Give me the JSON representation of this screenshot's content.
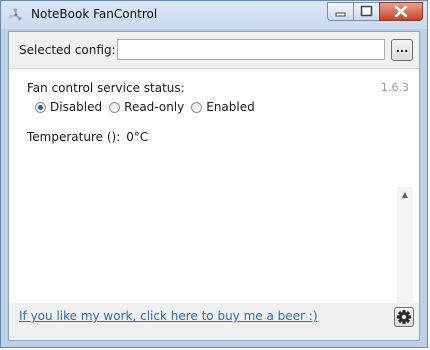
{
  "window": {
    "title": "NoteBook FanControl",
    "app_icon": "fan-icon",
    "caption_icons": [
      "minimize-icon",
      "maximize-icon",
      "close-icon"
    ]
  },
  "config": {
    "label": "Selected config:",
    "value": "",
    "browse_label": "..."
  },
  "status": {
    "label": "Fan control service status:",
    "version": "1.6.3",
    "options": [
      {
        "label": "Disabled",
        "checked": true
      },
      {
        "label": "Read-only",
        "checked": false
      },
      {
        "label": "Enabled",
        "checked": false
      }
    ]
  },
  "temperature": {
    "label": "Temperature ():",
    "value": "0°C"
  },
  "footer": {
    "link_text": "If you like my work, click here to buy me a beer :)",
    "settings_icon": "gear-icon"
  },
  "colors": {
    "link": "#2c6dbd",
    "radio_dot": "#1b5fa8",
    "close_button": "#c5432a"
  }
}
